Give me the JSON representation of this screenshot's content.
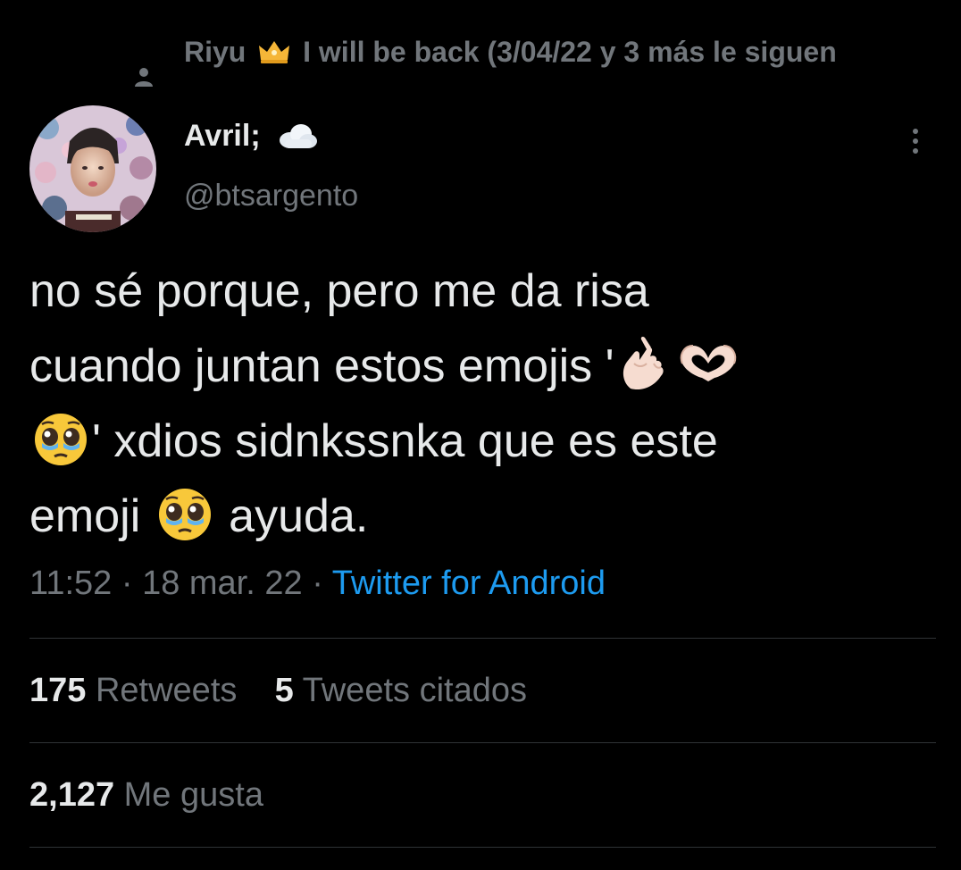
{
  "context": {
    "name": "Riyu",
    "emoji_icon": "crown-emoji",
    "text": "I will be back (3/04/22 y 3 más le siguen"
  },
  "author": {
    "display_name": "Avril;",
    "display_emoji": "cloud-emoji",
    "handle": "@btsargento"
  },
  "tweet": {
    "line1": "no sé porque, pero me da risa",
    "line2_start": "cuando juntan estos emojis '",
    "line3_rest": "' xdios sidnkssnka que es este",
    "line4_start": "emoji",
    "line4_end": "ayuda.",
    "emojis": [
      "finger-heart-emoji",
      "heart-hands-emoji",
      "pleading-tears-emoji"
    ]
  },
  "meta": {
    "time": "11:52",
    "sep1": "·",
    "date": "18 mar. 22",
    "sep2": "·",
    "source": "Twitter for Android"
  },
  "stats": {
    "retweets_count": "175",
    "retweets_label": "Retweets",
    "quotes_count": "5",
    "quotes_label": "Tweets citados",
    "likes_count": "2,127",
    "likes_label": "Me gusta"
  },
  "colors": {
    "background": "#000000",
    "primary_text": "#e7e9ea",
    "secondary_text": "#71767b",
    "link": "#1d9bf0",
    "divider": "#2f3336"
  }
}
